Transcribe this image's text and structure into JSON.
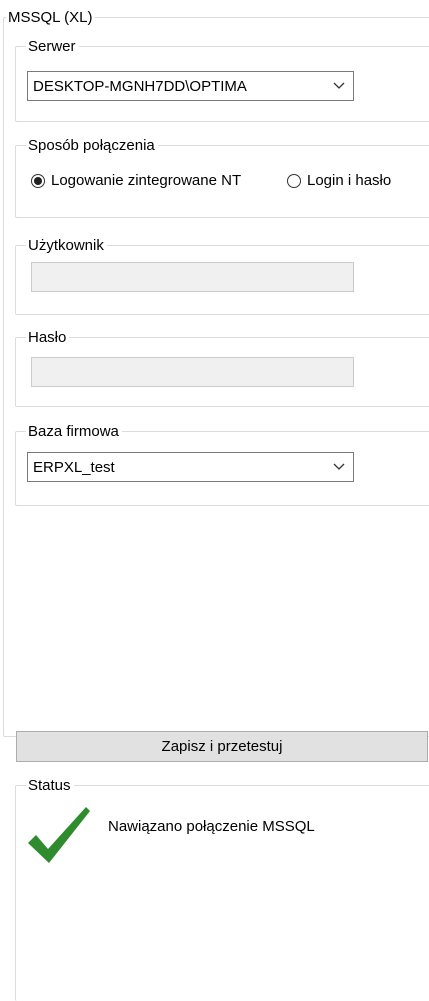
{
  "main_group": {
    "title": "MSSQL (XL)"
  },
  "server": {
    "title": "Serwer",
    "value": "DESKTOP-MGNH7DD\\OPTIMA"
  },
  "connection": {
    "title": "Sposób połączenia",
    "options": [
      {
        "label": "Logowanie zintegrowane NT",
        "selected": true
      },
      {
        "label": "Login i hasło",
        "selected": false
      }
    ]
  },
  "user": {
    "title": "Użytkownik",
    "value": ""
  },
  "password": {
    "title": "Hasło",
    "value": ""
  },
  "database": {
    "title": "Baza firmowa",
    "value": "ERPXL_test"
  },
  "save_button": {
    "label": "Zapisz i przetestuj"
  },
  "status": {
    "title": "Status",
    "message": "Nawiązano połączenie MSSQL",
    "icon": "checkmark-icon",
    "icon_color": "#2e8b2e"
  }
}
